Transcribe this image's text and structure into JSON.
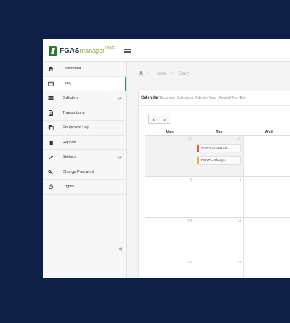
{
  "app": {
    "brand_fgas": "FGAS",
    "brand_manager": "manager",
    "brand_demo": "DEMO",
    "accent_color": "#2f8f4f",
    "background_color": "#0d1f45"
  },
  "sidebar": {
    "items": [
      {
        "label": "Dashboard",
        "icon": "home-icon",
        "active": false
      },
      {
        "label": "Diary",
        "icon": "calendar-icon",
        "active": true
      },
      {
        "label": "Cylinders",
        "icon": "list-icon",
        "active": false,
        "expandable": true
      },
      {
        "label": "Transactions",
        "icon": "document-icon",
        "active": false
      },
      {
        "label": "Equipment Log",
        "icon": "copy-icon",
        "active": false
      },
      {
        "label": "Reports",
        "icon": "book-icon",
        "active": false
      },
      {
        "label": "Settings",
        "icon": "wrench-icon",
        "active": false,
        "expandable": true
      },
      {
        "label": "Change Password",
        "icon": "key-icon",
        "active": false
      },
      {
        "label": "Logout",
        "icon": "power-icon",
        "active": false
      }
    ]
  },
  "breadcrumb": {
    "home": "Home",
    "separator": "/",
    "current": "Diary"
  },
  "calendar": {
    "title": "Calendar",
    "subtitle": "Upcoming Collections, Cylinder Tests , Rental / Non-Ret",
    "prev_label": "‹",
    "next_label": "›",
    "days": [
      "Mon",
      "Tue",
      "Wed"
    ],
    "weeks": [
      {
        "cells": [
          {
            "num": "29",
            "other": true
          },
          {
            "num": "30",
            "other": true
          },
          {
            "num": "",
            "other": false
          }
        ]
      },
      {
        "cells": [
          {
            "num": "6",
            "other": false
          },
          {
            "num": "7",
            "other": false
          },
          {
            "num": "",
            "other": false
          }
        ]
      },
      {
        "cells": [
          {
            "num": "13",
            "other": false
          },
          {
            "num": "14",
            "other": false
          },
          {
            "num": "",
            "other": false
          }
        ]
      },
      {
        "cells": [
          {
            "num": "20",
            "other": false
          },
          {
            "num": "21",
            "other": false
          },
          {
            "num": "",
            "other": false
          }
        ]
      }
    ],
    "events": [
      {
        "label": "NON-RETURN Ch...",
        "color": "#d9534f"
      },
      {
        "label": "RENTAL Charges",
        "color": "#f0ad4e"
      }
    ]
  }
}
